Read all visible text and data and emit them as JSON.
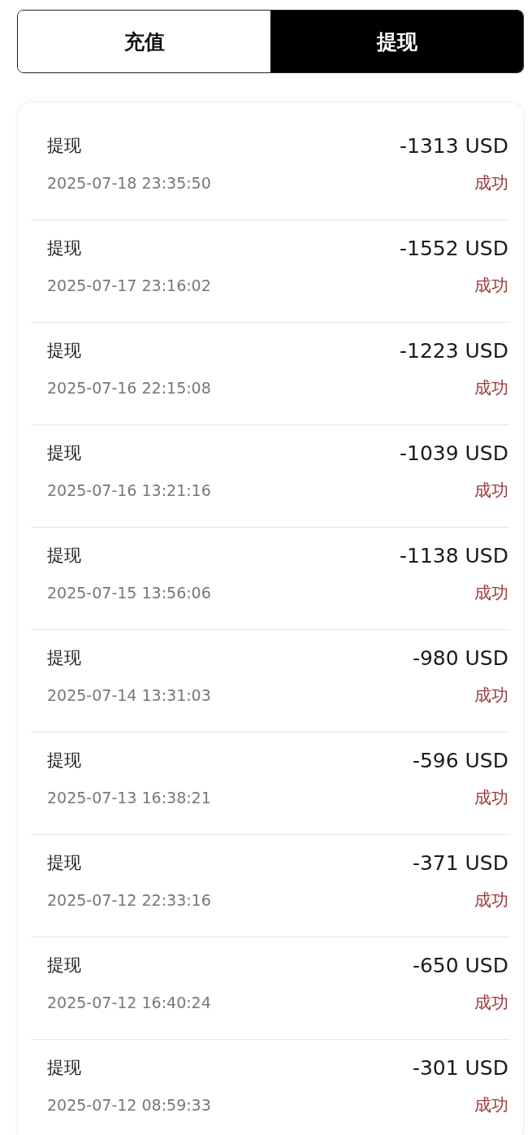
{
  "tabs": [
    {
      "label": "充值",
      "selected": false
    },
    {
      "label": "提现",
      "selected": true
    }
  ],
  "records": [
    {
      "title": "提现",
      "time": "2025-07-18 23:35:50",
      "amount": "-1313 USD",
      "status": "成功",
      "kind": "success"
    },
    {
      "title": "提现",
      "time": "2025-07-17 23:16:02",
      "amount": "-1552 USD",
      "status": "成功",
      "kind": "success"
    },
    {
      "title": "提现",
      "time": "2025-07-16 22:15:08",
      "amount": "-1223 USD",
      "status": "成功",
      "kind": "success"
    },
    {
      "title": "提现",
      "time": "2025-07-16 13:21:16",
      "amount": "-1039 USD",
      "status": "成功",
      "kind": "success"
    },
    {
      "title": "提现",
      "time": "2025-07-15 13:56:06",
      "amount": "-1138 USD",
      "status": "成功",
      "kind": "success"
    },
    {
      "title": "提现",
      "time": "2025-07-14 13:31:03",
      "amount": "-980 USD",
      "status": "成功",
      "kind": "success"
    },
    {
      "title": "提现",
      "time": "2025-07-13 16:38:21",
      "amount": "-596 USD",
      "status": "成功",
      "kind": "success"
    },
    {
      "title": "提现",
      "time": "2025-07-12 22:33:16",
      "amount": "-371 USD",
      "status": "成功",
      "kind": "success"
    },
    {
      "title": "提现",
      "time": "2025-07-12 16:40:24",
      "amount": "-650 USD",
      "status": "成功",
      "kind": "success"
    },
    {
      "title": "提现",
      "time": "2025-07-12 08:59:33",
      "amount": "-301 USD",
      "status": "成功",
      "kind": "success"
    }
  ]
}
